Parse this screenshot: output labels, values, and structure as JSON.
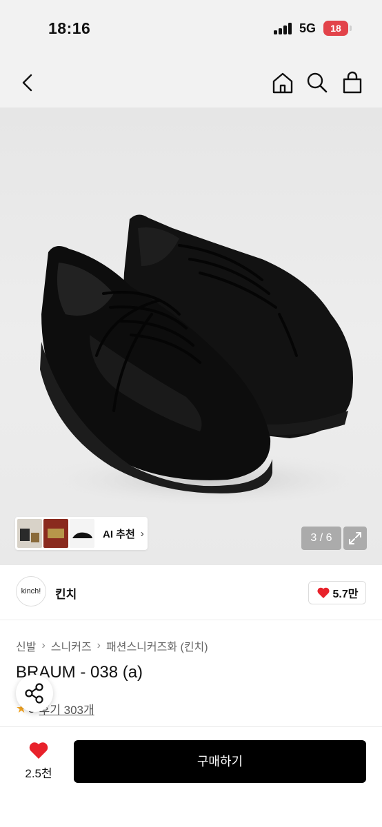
{
  "status_bar": {
    "time": "18:16",
    "network": "5G",
    "battery": "18"
  },
  "nav": {
    "icons": [
      "back-icon",
      "home-icon",
      "search-icon",
      "shopping-bag-icon"
    ]
  },
  "gallery": {
    "ai_label": "AI 추천",
    "counter": "3 / 6"
  },
  "brand": {
    "logo_text": "kinch!",
    "name": "킨치",
    "likes": "5.7만"
  },
  "product": {
    "breadcrumb": [
      "신발",
      "스니커즈",
      "패션스니커즈화 (킨치)"
    ],
    "title": "BRAUM - 038 (a)",
    "rating": "5",
    "reviews": "후기 303개"
  },
  "bottom_bar": {
    "wishlist_count": "2.5천",
    "buy_label": "구매하기"
  },
  "colors": {
    "accent": "#e8222b",
    "buy_button": "#000000",
    "star": "#f5a623"
  }
}
